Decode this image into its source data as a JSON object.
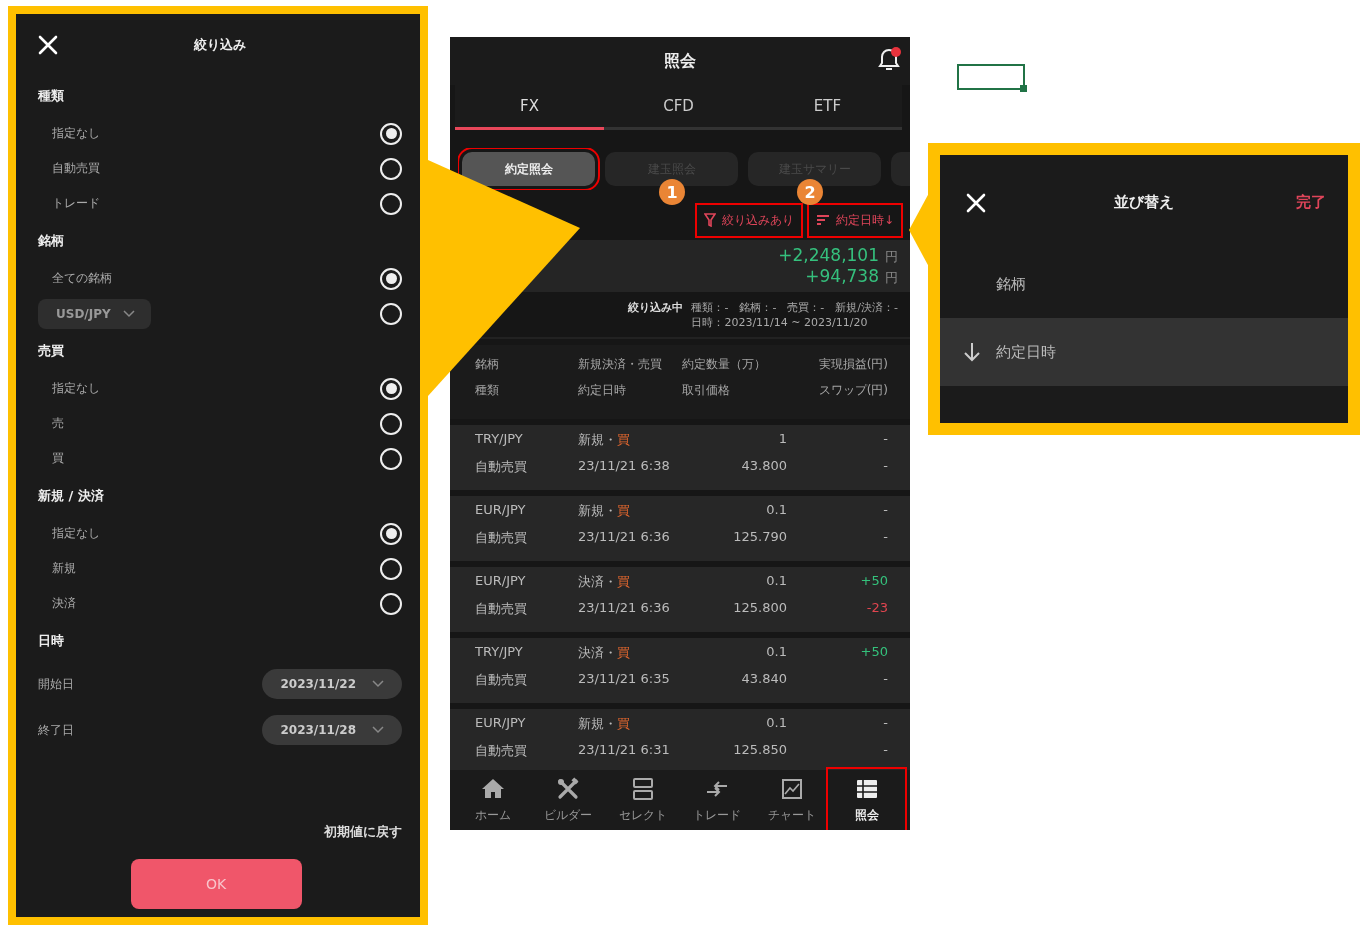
{
  "filter_panel": {
    "title": "絞り込み",
    "sections": [
      {
        "heading": "種類",
        "options": [
          {
            "kind": "radio",
            "label": "指定なし",
            "selected": true
          },
          {
            "kind": "radio",
            "label": "自動売買",
            "selected": false
          },
          {
            "kind": "radio",
            "label": "トレード",
            "selected": false
          }
        ]
      },
      {
        "heading": "銘柄",
        "options": [
          {
            "kind": "radio",
            "label": "全ての銘柄",
            "selected": true
          },
          {
            "kind": "dropdown",
            "label": "USD/JPY",
            "selected": false
          }
        ]
      },
      {
        "heading": "売買",
        "options": [
          {
            "kind": "radio",
            "label": "指定なし",
            "selected": true
          },
          {
            "kind": "radio",
            "label": "売",
            "selected": false
          },
          {
            "kind": "radio",
            "label": "買",
            "selected": false
          }
        ]
      },
      {
        "heading": "新規 / 決済",
        "options": [
          {
            "kind": "radio",
            "label": "指定なし",
            "selected": true
          },
          {
            "kind": "radio",
            "label": "新規",
            "selected": false
          },
          {
            "kind": "radio",
            "label": "決済",
            "selected": false
          }
        ]
      },
      {
        "heading": "日時",
        "options": [
          {
            "kind": "date",
            "label": "開始日",
            "value": "2023/11/22"
          },
          {
            "kind": "date",
            "label": "終了日",
            "value": "2023/11/28"
          }
        ]
      }
    ],
    "reset": "初期値に戻す",
    "ok": "OK"
  },
  "screen": {
    "title": "照会",
    "notification": true,
    "tabs": [
      {
        "label": "FX",
        "selected": true
      },
      {
        "label": "CFD",
        "selected": false
      },
      {
        "label": "ETF",
        "selected": false
      }
    ],
    "chips": [
      {
        "label": "約定照会",
        "selected": true,
        "highlighted": true
      },
      {
        "label": "建玉照会",
        "selected": false,
        "highlighted": false
      },
      {
        "label": "建玉サマリー",
        "selected": false,
        "highlighted": false
      }
    ],
    "filter_button": {
      "label": "絞り込みあり",
      "highlighted": true
    },
    "sort_button": {
      "label": "約定日時↓",
      "highlighted": true
    },
    "totals": [
      {
        "value": "+2,248,101",
        "unit": "円"
      },
      {
        "value": "+94,738",
        "unit": "円"
      }
    ],
    "filter_summary": {
      "heading": "絞り込み中",
      "conditions": "種類：-　銘柄：-　売買：-　新規/決済：-",
      "period": "日時：2023/11/14 ~ 2023/11/20"
    },
    "columns": [
      {
        "top": "銘柄",
        "bottom": "種類"
      },
      {
        "top": "新規決済・売買",
        "bottom": "約定日時"
      },
      {
        "top": "約定数量（万）",
        "bottom": "取引価格"
      },
      {
        "top": "実現損益(円)",
        "bottom": "スワップ(円)"
      }
    ],
    "rows": [
      {
        "pair": "TRY/JPY",
        "type": "自動売買",
        "action": "新規・",
        "side": "買",
        "date": "23/11/21 6:38",
        "qty": "1",
        "price": "43.800",
        "pnl": {
          "text": "-",
          "color": "#bbbbbb"
        },
        "swap": {
          "text": "-",
          "color": "#bbbbbb"
        }
      },
      {
        "pair": "EUR/JPY",
        "type": "自動売買",
        "action": "新規・",
        "side": "買",
        "date": "23/11/21 6:36",
        "qty": "0.1",
        "price": "125.790",
        "pnl": {
          "text": "-",
          "color": "#bbbbbb"
        },
        "swap": {
          "text": "-",
          "color": "#bbbbbb"
        }
      },
      {
        "pair": "EUR/JPY",
        "type": "自動売買",
        "action": "決済・",
        "side": "買",
        "date": "23/11/21 6:36",
        "qty": "0.1",
        "price": "125.800",
        "pnl": {
          "text": "+50",
          "color": "#34c27c"
        },
        "swap": {
          "text": "-23",
          "color": "#e0454f"
        }
      },
      {
        "pair": "TRY/JPY",
        "type": "自動売買",
        "action": "決済・",
        "side": "買",
        "date": "23/11/21 6:35",
        "qty": "0.1",
        "price": "43.840",
        "pnl": {
          "text": "+50",
          "color": "#34c27c"
        },
        "swap": {
          "text": "-",
          "color": "#bbbbbb"
        }
      },
      {
        "pair": "EUR/JPY",
        "type": "自動売買",
        "action": "新規・",
        "side": "買",
        "date": "23/11/21 6:31",
        "qty": "0.1",
        "price": "125.850",
        "pnl": {
          "text": "-",
          "color": "#bbbbbb"
        },
        "swap": {
          "text": "-",
          "color": "#bbbbbb"
        }
      }
    ],
    "nav": [
      {
        "kind": "home",
        "label": "ホーム",
        "selected": false,
        "highlighted": false
      },
      {
        "kind": "builder",
        "label": "ビルダー",
        "selected": false,
        "highlighted": false
      },
      {
        "kind": "select",
        "label": "セレクト",
        "selected": false,
        "highlighted": false
      },
      {
        "kind": "trade",
        "label": "トレード",
        "selected": false,
        "highlighted": false
      },
      {
        "kind": "chart",
        "label": "チャート",
        "selected": false,
        "highlighted": false
      },
      {
        "kind": "inquiry",
        "label": "照会",
        "selected": true,
        "highlighted": true
      }
    ]
  },
  "sort_panel": {
    "title": "並び替え",
    "done": "完了",
    "items": [
      {
        "label": "銘柄",
        "selected": false
      },
      {
        "label": "約定日時",
        "selected": true
      }
    ]
  },
  "callouts": [
    {
      "number": "1"
    },
    {
      "number": "2"
    }
  ]
}
